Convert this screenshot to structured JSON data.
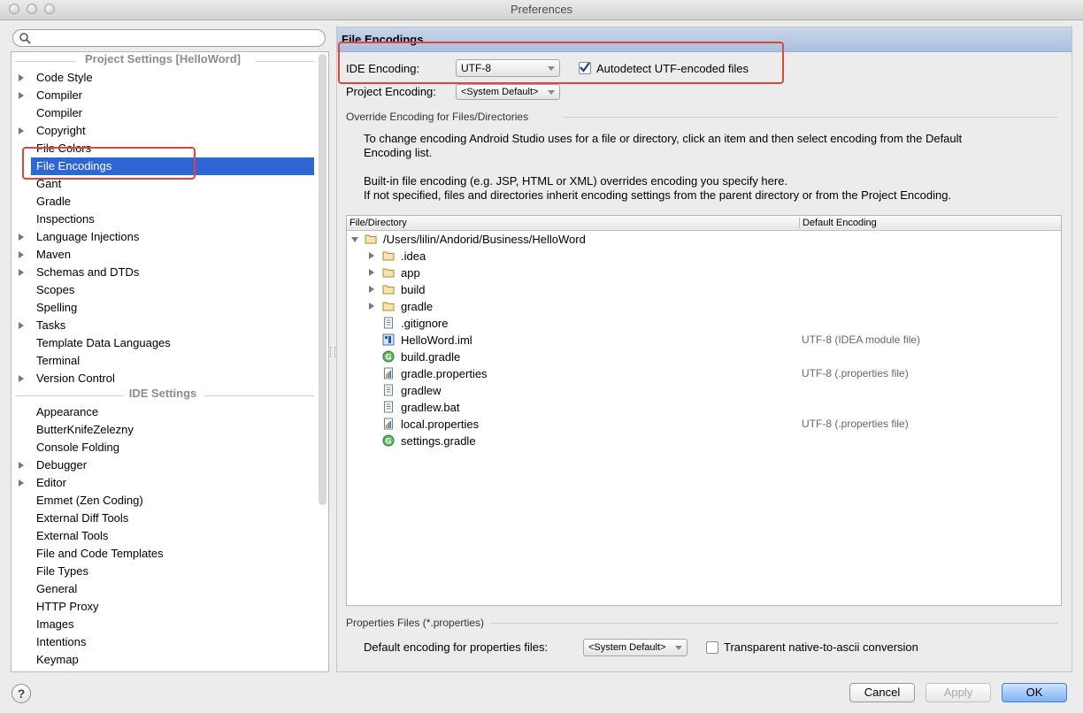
{
  "window": {
    "title": "Preferences"
  },
  "search": {
    "placeholder": ""
  },
  "sidebar": {
    "project_header": "Project Settings [HelloWord]",
    "ide_header": "IDE Settings",
    "project_items": [
      {
        "label": "Code Style",
        "expandable": true
      },
      {
        "label": "Compiler",
        "expandable": true
      },
      {
        "label": "Compiler",
        "expandable": false
      },
      {
        "label": "Copyright",
        "expandable": true
      },
      {
        "label": "File Colors",
        "expandable": false
      },
      {
        "label": "File Encodings",
        "expandable": false,
        "selected": true
      },
      {
        "label": "Gant",
        "expandable": false
      },
      {
        "label": "Gradle",
        "expandable": false
      },
      {
        "label": "Inspections",
        "expandable": false
      },
      {
        "label": "Language Injections",
        "expandable": true
      },
      {
        "label": "Maven",
        "expandable": true
      },
      {
        "label": "Schemas and DTDs",
        "expandable": true
      },
      {
        "label": "Scopes",
        "expandable": false
      },
      {
        "label": "Spelling",
        "expandable": false
      },
      {
        "label": "Tasks",
        "expandable": true
      },
      {
        "label": "Template Data Languages",
        "expandable": false
      },
      {
        "label": "Terminal",
        "expandable": false
      },
      {
        "label": "Version Control",
        "expandable": true
      }
    ],
    "ide_items": [
      {
        "label": "Appearance",
        "expandable": false
      },
      {
        "label": "ButterKnifeZelezny",
        "expandable": false
      },
      {
        "label": "Console Folding",
        "expandable": false
      },
      {
        "label": "Debugger",
        "expandable": true
      },
      {
        "label": "Editor",
        "expandable": true
      },
      {
        "label": "Emmet (Zen Coding)",
        "expandable": false
      },
      {
        "label": "External Diff Tools",
        "expandable": false
      },
      {
        "label": "External Tools",
        "expandable": false
      },
      {
        "label": "File and Code Templates",
        "expandable": false
      },
      {
        "label": "File Types",
        "expandable": false
      },
      {
        "label": "General",
        "expandable": false
      },
      {
        "label": "HTTP Proxy",
        "expandable": false
      },
      {
        "label": "Images",
        "expandable": false
      },
      {
        "label": "Intentions",
        "expandable": false
      },
      {
        "label": "Keymap",
        "expandable": false
      }
    ]
  },
  "panel": {
    "title": "File Encodings",
    "ide_encoding_label": "IDE Encoding:",
    "ide_encoding_value": "UTF-8",
    "autodetect_label": "Autodetect UTF-encoded files",
    "autodetect_checked": true,
    "project_encoding_label": "Project Encoding:",
    "project_encoding_value": "<System Default>",
    "override_group": "Override Encoding for Files/Directories",
    "desc_line1": "To change encoding Android Studio uses for a file or directory, click an item and then select encoding from the Default",
    "desc_line2": "Encoding list.",
    "desc_line3": "Built-in file encoding (e.g. JSP, HTML or XML) overrides encoding you specify here.",
    "desc_line4": "If not specified, files and directories inherit encoding settings from the parent directory or from the Project Encoding.",
    "table": {
      "col_file": "File/Directory",
      "col_encoding": "Default Encoding",
      "rows": [
        {
          "name": "/Users/lilin/Andorid/Business/HelloWord",
          "encoding": "",
          "icon": "folder-icon",
          "level": 0,
          "arrow": "down"
        },
        {
          "name": ".idea",
          "encoding": "",
          "icon": "folder-icon",
          "level": 1,
          "arrow": "right"
        },
        {
          "name": "app",
          "encoding": "",
          "icon": "folder-icon",
          "level": 1,
          "arrow": "right"
        },
        {
          "name": "build",
          "encoding": "",
          "icon": "folder-icon",
          "level": 1,
          "arrow": "right"
        },
        {
          "name": "gradle",
          "encoding": "",
          "icon": "folder-icon",
          "level": 1,
          "arrow": "right"
        },
        {
          "name": ".gitignore",
          "encoding": "",
          "icon": "text-file-icon",
          "level": 1,
          "arrow": ""
        },
        {
          "name": "HelloWord.iml",
          "encoding": "UTF-8 (IDEA module file)",
          "icon": "module-file-icon",
          "level": 1,
          "arrow": ""
        },
        {
          "name": "build.gradle",
          "encoding": "",
          "icon": "gradle-file-icon",
          "level": 1,
          "arrow": ""
        },
        {
          "name": "gradle.properties",
          "encoding": "UTF-8 (.properties file)",
          "icon": "properties-file-icon",
          "level": 1,
          "arrow": ""
        },
        {
          "name": "gradlew",
          "encoding": "",
          "icon": "text-file-icon",
          "level": 1,
          "arrow": ""
        },
        {
          "name": "gradlew.bat",
          "encoding": "",
          "icon": "text-file-icon",
          "level": 1,
          "arrow": ""
        },
        {
          "name": "local.properties",
          "encoding": "UTF-8 (.properties file)",
          "icon": "properties-file-icon",
          "level": 1,
          "arrow": ""
        },
        {
          "name": "settings.gradle",
          "encoding": "",
          "icon": "gradle-file-icon",
          "level": 1,
          "arrow": ""
        }
      ]
    },
    "properties_group": "Properties Files (*.properties)",
    "default_props_label": "Default encoding for properties files:",
    "default_props_value": "<System Default>",
    "transparent_label": "Transparent native-to-ascii conversion",
    "transparent_checked": false
  },
  "footer": {
    "help_label": "?",
    "cancel_label": "Cancel",
    "apply_label": "Apply",
    "ok_label": "OK"
  },
  "colors": {
    "selection": "#2f66d6",
    "highlight_box": "#e0443a",
    "panel_title_bg": "#b8cae6"
  }
}
